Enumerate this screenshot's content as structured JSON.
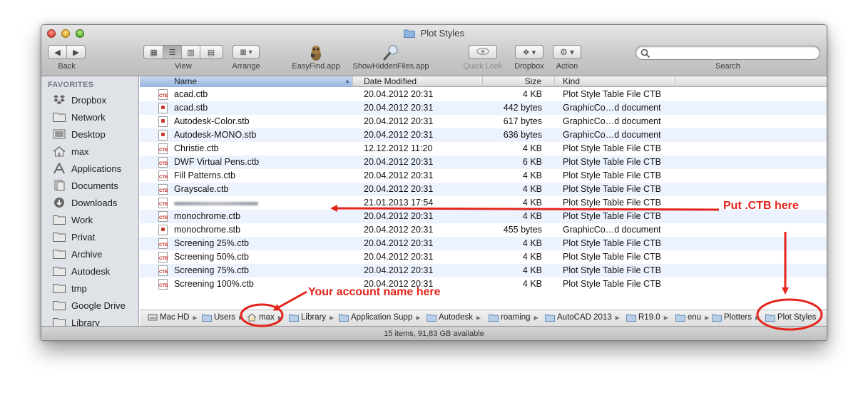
{
  "window": {
    "title": "Plot Styles"
  },
  "toolbar": {
    "back_label": "Back",
    "view_label": "View",
    "arrange_label": "Arrange",
    "app1_label": "EasyFind.app",
    "app2_label": "ShowHiddenFiles.app",
    "quicklook_label": "Quick Look",
    "dropbox_label": "Dropbox",
    "action_label": "Action",
    "search_label": "Search",
    "search_placeholder": ""
  },
  "sidebar": {
    "heading": "FAVORITES",
    "items": [
      {
        "label": "Dropbox",
        "icon": "dropbox-icon"
      },
      {
        "label": "Network",
        "icon": "folder-icon"
      },
      {
        "label": "Desktop",
        "icon": "desktop-icon"
      },
      {
        "label": "max",
        "icon": "home-icon"
      },
      {
        "label": "Applications",
        "icon": "applications-icon"
      },
      {
        "label": "Documents",
        "icon": "documents-icon"
      },
      {
        "label": "Downloads",
        "icon": "downloads-icon"
      },
      {
        "label": "Work",
        "icon": "folder-icon"
      },
      {
        "label": "Privat",
        "icon": "folder-icon"
      },
      {
        "label": "Archive",
        "icon": "folder-icon"
      },
      {
        "label": "Autodesk",
        "icon": "folder-icon"
      },
      {
        "label": "tmp",
        "icon": "folder-icon"
      },
      {
        "label": "Google Drive",
        "icon": "folder-icon"
      },
      {
        "label": "Library",
        "icon": "folder-icon"
      }
    ]
  },
  "columns": {
    "name": "Name",
    "date": "Date Modified",
    "size": "Size",
    "kind": "Kind"
  },
  "files": [
    {
      "name": "acad.ctb",
      "date": "20.04.2012 20:31",
      "size": "4 KB",
      "kind": "Plot Style Table File CTB",
      "type": "ctb"
    },
    {
      "name": "acad.stb",
      "date": "20.04.2012 20:31",
      "size": "442 bytes",
      "kind": "GraphicCo…d document",
      "type": "stb"
    },
    {
      "name": "Autodesk-Color.stb",
      "date": "20.04.2012 20:31",
      "size": "617 bytes",
      "kind": "GraphicCo…d document",
      "type": "stb"
    },
    {
      "name": "Autodesk-MONO.stb",
      "date": "20.04.2012 20:31",
      "size": "636 bytes",
      "kind": "GraphicCo…d document",
      "type": "stb"
    },
    {
      "name": "Christie.ctb",
      "date": "12.12.2012 11:20",
      "size": "4 KB",
      "kind": "Plot Style Table File CTB",
      "type": "ctb"
    },
    {
      "name": "DWF Virtual Pens.ctb",
      "date": "20.04.2012 20:31",
      "size": "6 KB",
      "kind": "Plot Style Table File CTB",
      "type": "ctb"
    },
    {
      "name": "Fill Patterns.ctb",
      "date": "20.04.2012 20:31",
      "size": "4 KB",
      "kind": "Plot Style Table File CTB",
      "type": "ctb"
    },
    {
      "name": "Grayscale.ctb",
      "date": "20.04.2012 20:31",
      "size": "4 KB",
      "kind": "Plot Style Table File CTB",
      "type": "ctb"
    },
    {
      "name": "",
      "date": "21.01.2013 17:54",
      "size": "4 KB",
      "kind": "Plot Style Table File CTB",
      "type": "ctb",
      "blurred": true
    },
    {
      "name": "monochrome.ctb",
      "date": "20.04.2012 20:31",
      "size": "4 KB",
      "kind": "Plot Style Table File CTB",
      "type": "ctb"
    },
    {
      "name": "monochrome.stb",
      "date": "20.04.2012 20:31",
      "size": "455 bytes",
      "kind": "GraphicCo…d document",
      "type": "stb"
    },
    {
      "name": "Screening 25%.ctb",
      "date": "20.04.2012 20:31",
      "size": "4 KB",
      "kind": "Plot Style Table File CTB",
      "type": "ctb"
    },
    {
      "name": "Screening 50%.ctb",
      "date": "20.04.2012 20:31",
      "size": "4 KB",
      "kind": "Plot Style Table File CTB",
      "type": "ctb"
    },
    {
      "name": "Screening 75%.ctb",
      "date": "20.04.2012 20:31",
      "size": "4 KB",
      "kind": "Plot Style Table File CTB",
      "type": "ctb"
    },
    {
      "name": "Screening 100%.ctb",
      "date": "20.04.2012 20:31",
      "size": "4 KB",
      "kind": "Plot Style Table File CTB",
      "type": "ctb"
    }
  ],
  "file_icon_label": "CTB",
  "path": [
    {
      "label": "Mac HD",
      "icon": "hard-drive-icon"
    },
    {
      "label": "Users",
      "icon": "folder-icon"
    },
    {
      "label": "max",
      "icon": "home-icon"
    },
    {
      "label": "Library",
      "icon": "folder-icon"
    },
    {
      "label": "Application Supp",
      "icon": "folder-icon"
    },
    {
      "label": "Autodesk",
      "icon": "folder-icon"
    },
    {
      "label": "roaming",
      "icon": "folder-icon"
    },
    {
      "label": "AutoCAD 2013",
      "icon": "folder-icon"
    },
    {
      "label": "R19.0",
      "icon": "folder-icon"
    },
    {
      "label": "enu",
      "icon": "folder-icon"
    },
    {
      "label": "Plotters",
      "icon": "folder-icon"
    },
    {
      "label": "Plot Styles",
      "icon": "folder-icon"
    }
  ],
  "status": "15 items, 91,83 GB available",
  "annotations": {
    "put_ctb": "Put .CTB here",
    "account": "Your account name here"
  },
  "colors": {
    "annotation": "#e3241b",
    "row_alt": "#edf3fe",
    "sidebar_bg": "#dfe3e8"
  }
}
